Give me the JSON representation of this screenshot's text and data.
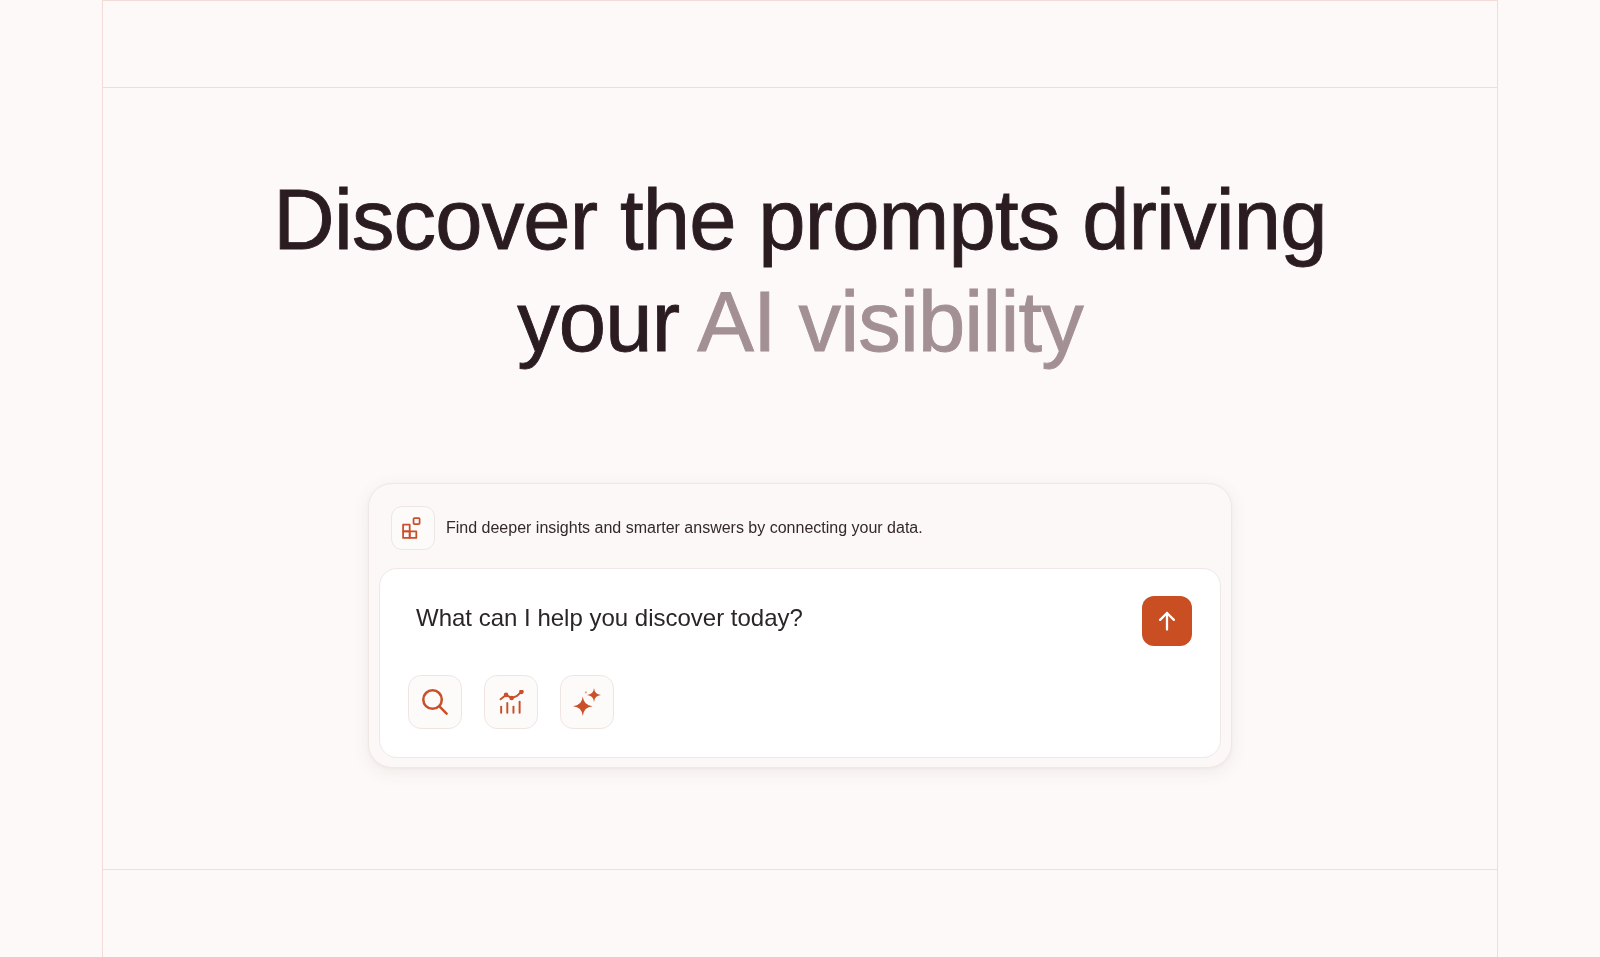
{
  "headline": {
    "segments": [
      {
        "text": "Discover the prompts driving your",
        "muted": false
      },
      {
        "text": "AI visibility",
        "muted": true
      }
    ]
  },
  "composer": {
    "connect_hint": "Find deeper insights and smarter answers by connecting your data.",
    "input": {
      "placeholder": "What can I help you discover today?"
    },
    "tools": [
      {
        "kind": "search"
      },
      {
        "kind": "chart"
      },
      {
        "kind": "sparkle"
      }
    ]
  }
}
